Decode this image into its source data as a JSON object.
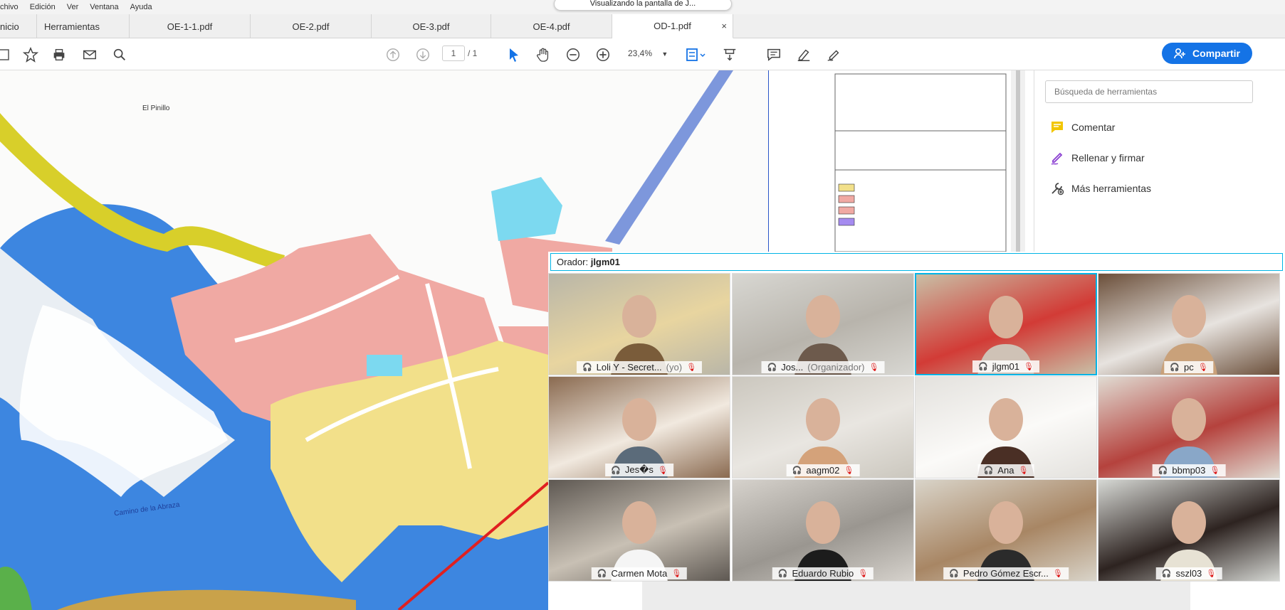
{
  "menu": [
    "chivo",
    "Edición",
    "Ver",
    "Ventana",
    "Ayuda"
  ],
  "share_banner": "Visualizando la pantalla de J...",
  "tabs": {
    "home": "nicio",
    "tools": "Herramientas",
    "docs": [
      "OE-1-1.pdf",
      "OE-2.pdf",
      "OE-3.pdf",
      "OE-4.pdf",
      "OD-1.pdf"
    ],
    "close": "×"
  },
  "toolbar": {
    "page_current": "1",
    "page_total": "/ 1",
    "zoom": "23,4%",
    "share_label": "Compartir"
  },
  "map": {
    "place_name": "El Pinillo",
    "label_bottom": "Camino de la Abraza"
  },
  "right_panel": {
    "search_placeholder": "Búsqueda de herramientas",
    "tools": [
      "Comentar",
      "Rellenar y firmar",
      "Más herramientas"
    ]
  },
  "meeting": {
    "speaker_prefix": "Orador:",
    "speaker_name": "jlgm01",
    "participants": [
      {
        "name": "Loli Y - Secret...",
        "role": "(yo)"
      },
      {
        "name": "Jos...",
        "role": "(Organizador)"
      },
      {
        "name": "jlgm01",
        "role": ""
      },
      {
        "name": "pc",
        "role": ""
      },
      {
        "name": "Jes�s",
        "role": ""
      },
      {
        "name": "aagm02",
        "role": ""
      },
      {
        "name": "Ana",
        "role": ""
      },
      {
        "name": "bbmp03",
        "role": ""
      },
      {
        "name": "Carmen Mota",
        "role": ""
      },
      {
        "name": "Eduardo Rubio",
        "role": ""
      },
      {
        "name": "Pedro Gómez Escr...",
        "role": ""
      },
      {
        "name": "sszl03",
        "role": ""
      }
    ]
  },
  "colors": {
    "accent": "#1473e6",
    "active_border": "#00b4e6",
    "water": "#3d86e0",
    "urban_pink": "#f0a9a3",
    "urban_yellow": "#f2e08a",
    "road_yellow": "#d8cf2a"
  }
}
